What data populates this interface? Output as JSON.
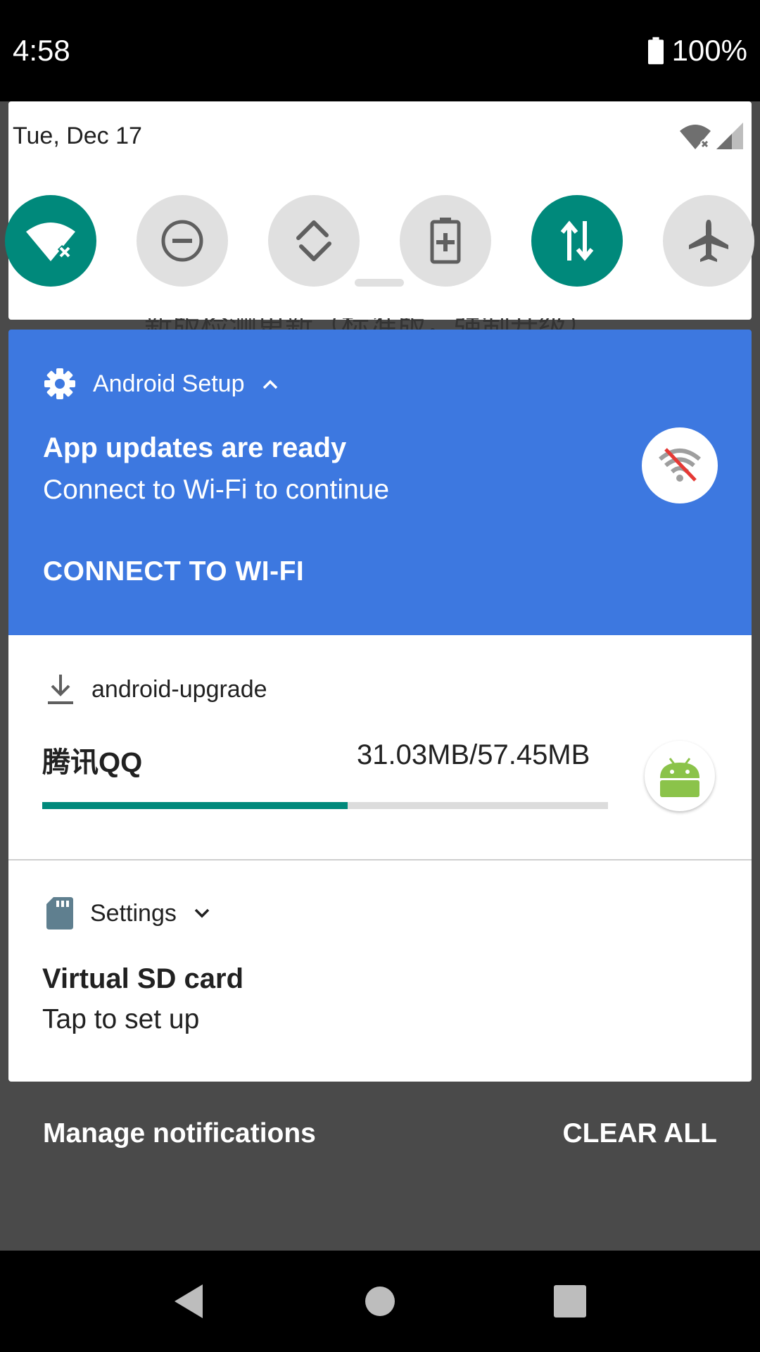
{
  "status_bar": {
    "time": "4:58",
    "battery": "100%"
  },
  "quick_settings": {
    "date": "Tue, Dec 17",
    "tiles": [
      {
        "icon": "wifi-off-icon",
        "active": true
      },
      {
        "icon": "do-not-disturb-icon",
        "active": false
      },
      {
        "icon": "auto-rotate-icon",
        "active": false
      },
      {
        "icon": "battery-saver-icon",
        "active": false
      },
      {
        "icon": "mobile-data-icon",
        "active": true
      },
      {
        "icon": "airplane-mode-icon",
        "active": false
      }
    ]
  },
  "background_peek_text": "新版检测更新（标准版，强制升级）",
  "notifications": {
    "setup": {
      "app": "Android Setup",
      "title": "App updates are ready",
      "text": "Connect to Wi-Fi to continue",
      "action": "CONNECT TO WI-FI"
    },
    "download": {
      "app": "android-upgrade",
      "name": "腾讯QQ",
      "size": "31.03MB/57.45MB",
      "progress": 0.54
    },
    "settings": {
      "app": "Settings",
      "title": "Virtual SD card",
      "text": "Tap to set up"
    }
  },
  "footer": {
    "manage": "Manage notifications",
    "clear": "CLEAR ALL"
  },
  "colors": {
    "accent_teal": "#00897b",
    "setup_blue": "#3d78e0",
    "android_green": "#8bc34a"
  }
}
